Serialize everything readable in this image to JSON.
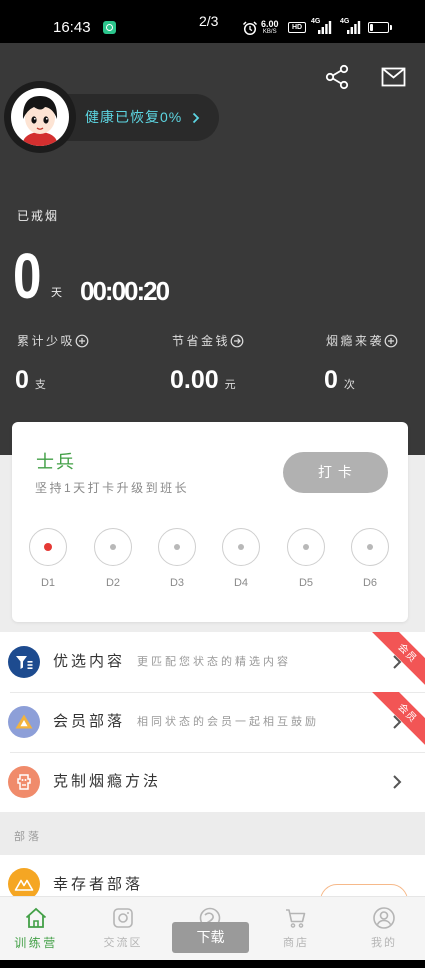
{
  "status_bar": {
    "time": "16:43",
    "page_indicator": "2/3",
    "net_speed": "6.00",
    "net_unit": "KB/S",
    "hd_label": "HD",
    "network_1": "4G",
    "network_2": "4G",
    "battery_level": 0.15
  },
  "header": {
    "actions": [
      {
        "icon": "share-icon"
      },
      {
        "icon": "mail-icon"
      }
    ],
    "health_status": "健康已恢复0%",
    "quit_label": "已戒烟",
    "days": "0",
    "days_unit": "天",
    "elapsed": "00:00:20"
  },
  "stats": [
    {
      "label": "累计少吸",
      "icon": "plus-circle-icon",
      "value": "0",
      "unit": "支"
    },
    {
      "label": "节省金钱",
      "icon": "arrow-circle-icon",
      "value": "0.00",
      "unit": "元"
    },
    {
      "label": "烟瘾来袭",
      "icon": "plus-circle-icon",
      "value": "0",
      "unit": "次"
    }
  ],
  "rank_card": {
    "rank": "士兵",
    "hint": "坚持1天打卡升级到班长",
    "checkin_label": "打 卡",
    "days": [
      {
        "label": "D1",
        "current": true
      },
      {
        "label": "D2",
        "current": false
      },
      {
        "label": "D3",
        "current": false
      },
      {
        "label": "D4",
        "current": false
      },
      {
        "label": "D5",
        "current": false
      },
      {
        "label": "D6",
        "current": false
      }
    ]
  },
  "menu": {
    "items": [
      {
        "title": "优选内容",
        "desc": "更匹配您状态的精选内容",
        "badge": "会员",
        "icon": "filter-icon",
        "icon_color": "#1d4b8f"
      },
      {
        "title": "会员部落",
        "desc": "相同状态的会员一起相互鼓励",
        "badge": "会员",
        "icon": "triangle-icon",
        "icon_color": "#8d9fd8"
      },
      {
        "title": "克制烟瘾方法",
        "icon": "craving-control-icon",
        "icon_color": "#f08b6b"
      }
    ]
  },
  "section": {
    "title": "部落"
  },
  "tribe": {
    "title": "幸存者部落",
    "icon": "mountain-icon",
    "icon_color": "#f5a623"
  },
  "tabbar": {
    "items": [
      {
        "label": "训练营",
        "icon": "home-icon",
        "active": true
      },
      {
        "label": "交流区",
        "icon": "chat-icon",
        "active": false
      },
      {
        "icon": "emblem-icon",
        "active": false
      },
      {
        "label": "商店",
        "icon": "cart-icon",
        "active": false
      },
      {
        "label": "我的",
        "icon": "user-icon",
        "active": false
      }
    ]
  },
  "download_label": "下载",
  "colors": {
    "header_bg": "#393939",
    "accent_green": "#43a047",
    "health_text": "#5dd6e2",
    "badge_red": "#f25555",
    "current_day_dot": "#e53935"
  }
}
